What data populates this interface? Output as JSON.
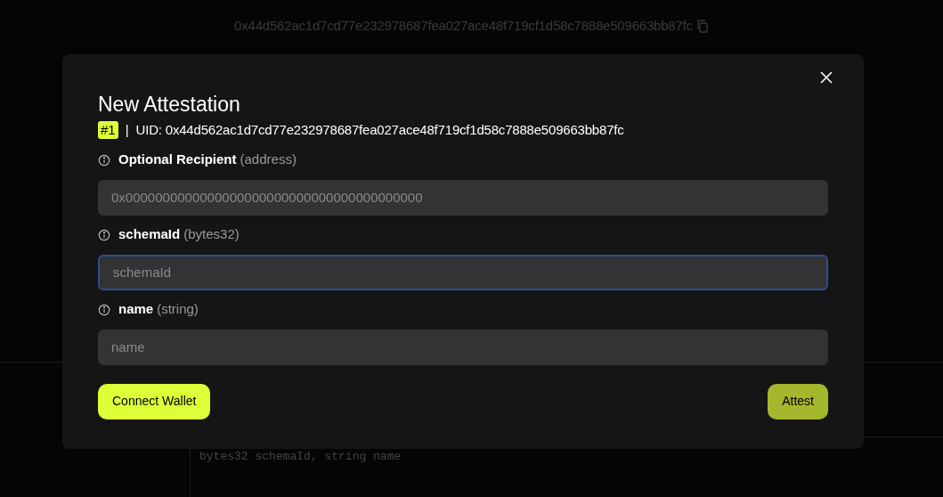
{
  "background": {
    "uid": "0x44d562ac1d7cd77e232978687fea027ace48f719cf1d58c7888e509663bb87fc",
    "schema_code": "bytes32 schemaId, string name"
  },
  "dialog": {
    "title": "New Attestation",
    "badge": "#1",
    "separator": "|",
    "uid": "UID: 0x44d562ac1d7cd77e232978687fea027ace48f719cf1d58c7888e509663bb87fc",
    "fields": [
      {
        "label": "Optional Recipient",
        "type": "(address)",
        "placeholder": "0x0000000000000000000000000000000000000000",
        "focused": false
      },
      {
        "label": "schemaId",
        "type": "(bytes32)",
        "placeholder": "schemaId",
        "focused": true
      },
      {
        "label": "name",
        "type": "(string)",
        "placeholder": "name",
        "focused": false
      }
    ],
    "buttons": [
      {
        "label": "Connect Wallet",
        "disabled": false
      },
      {
        "label": "Attest",
        "disabled": true
      }
    ]
  }
}
